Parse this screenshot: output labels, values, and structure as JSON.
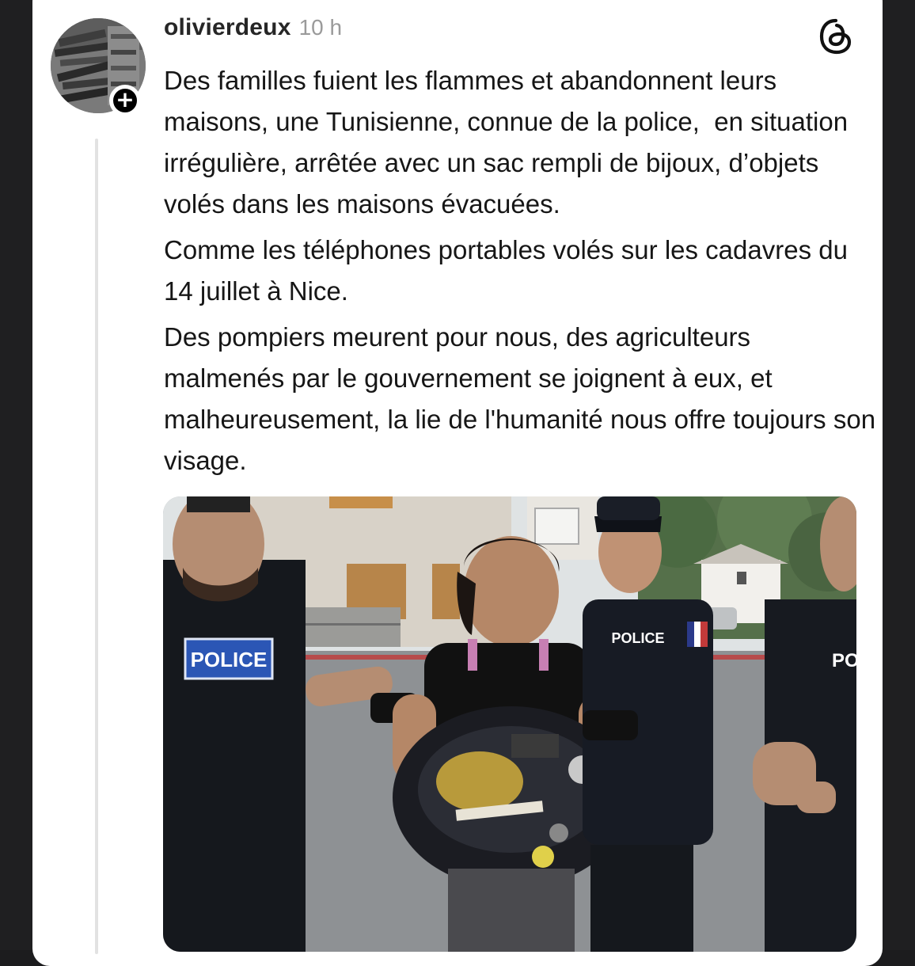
{
  "post": {
    "username": "olivierdeux",
    "time": "10 h",
    "paragraphs": [
      "Des familles fuient les flammes et abandonnent leurs maisons, une Tunisienne, connue de la police,  en situation irrégulière, arrêtée avec un sac rempli de bijoux, d’objets volés dans les maisons évacuées.",
      "Comme les téléphones portables volés sur les cadavres du 14 juillet à Nice.",
      "Des pompiers meurent pour nous, des agriculteurs malmenés par le gouvernement se joignent à eux, et malheureusement, la lie de l'humanité nous offre toujours son visage."
    ]
  },
  "icons": {
    "follow": "plus-icon",
    "app_logo": "threads-logo-icon"
  },
  "photo": {
    "patch_left": "POLICE",
    "shirt_middle": "POLICE",
    "vest_right": "POLI"
  },
  "colors": {
    "text": "#161616",
    "username": "#262626",
    "time": "#9a9a9a",
    "police_patch": "#2b56b5"
  }
}
